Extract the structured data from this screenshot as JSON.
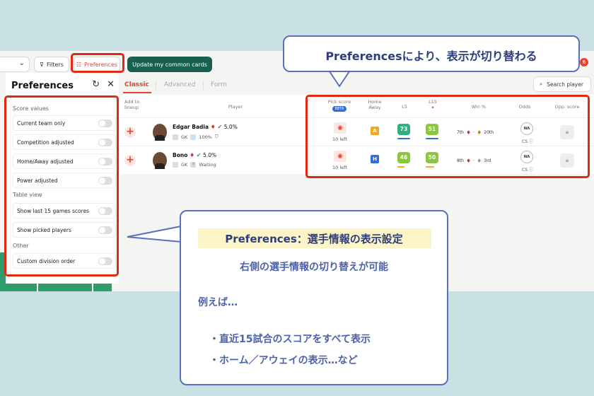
{
  "topbar": {
    "filters_label": "Filters",
    "preferences_label": "Preferences",
    "update_label": "Update my common cards",
    "notification_count": "6"
  },
  "tabs": [
    "Classic",
    "Advanced",
    "Form"
  ],
  "search_placeholder": "Search player",
  "panel": {
    "title": "Preferences",
    "sections": [
      {
        "title": "Score values",
        "options": [
          "Current team only",
          "Competition adjusted",
          "Home/Away adjusted",
          "Power adjusted"
        ]
      },
      {
        "title": "Table view",
        "options": [
          "Show last 15 games scores",
          "Show picked players"
        ]
      },
      {
        "title": "Other",
        "options": [
          "Custom division order"
        ]
      }
    ]
  },
  "table": {
    "headers": {
      "add": "Add to lineup",
      "player": "Player",
      "pick": "Pick score",
      "beta": "BETA",
      "home_away": "Home Away",
      "l5": "L5",
      "l15": "L15",
      "win": "Win %",
      "odds": "Odds",
      "opp": "Opp. score"
    },
    "rows": [
      {
        "name": "Edgar Badia",
        "pct": "5.0%",
        "pos": "GK",
        "meta": "100%",
        "left": "10 left",
        "ha": "A",
        "l5": "73",
        "l15": "51",
        "win_a": "7th",
        "win_b": "20th",
        "odds": "NA",
        "cs": "CS"
      },
      {
        "name": "Bono",
        "pct": "5.0%",
        "pos": "GK",
        "meta": "Waiting",
        "left": "10 left",
        "ha": "H",
        "l5": "46",
        "l15": "50",
        "win_a": "8th",
        "win_b": "3rd",
        "odds": "NA",
        "cs": "CS"
      }
    ]
  },
  "callouts": {
    "top": "Preferencesにより、表示が切り替わる",
    "main_title": "Preferences：選手情報の表示設定",
    "line1": "右側の選手情報の切り替えが可能",
    "line2": "例えば…",
    "line3": "・直近15試合のスコアをすべて表示",
    "line4": "・ホーム／アウェイの表示…など"
  },
  "colors": {
    "accent_red": "#e02a16",
    "update_green": "#17604f",
    "callout_blue": "#2c3e7a",
    "score_teal": "#2fb07e",
    "score_lime": "#8cc63f"
  }
}
